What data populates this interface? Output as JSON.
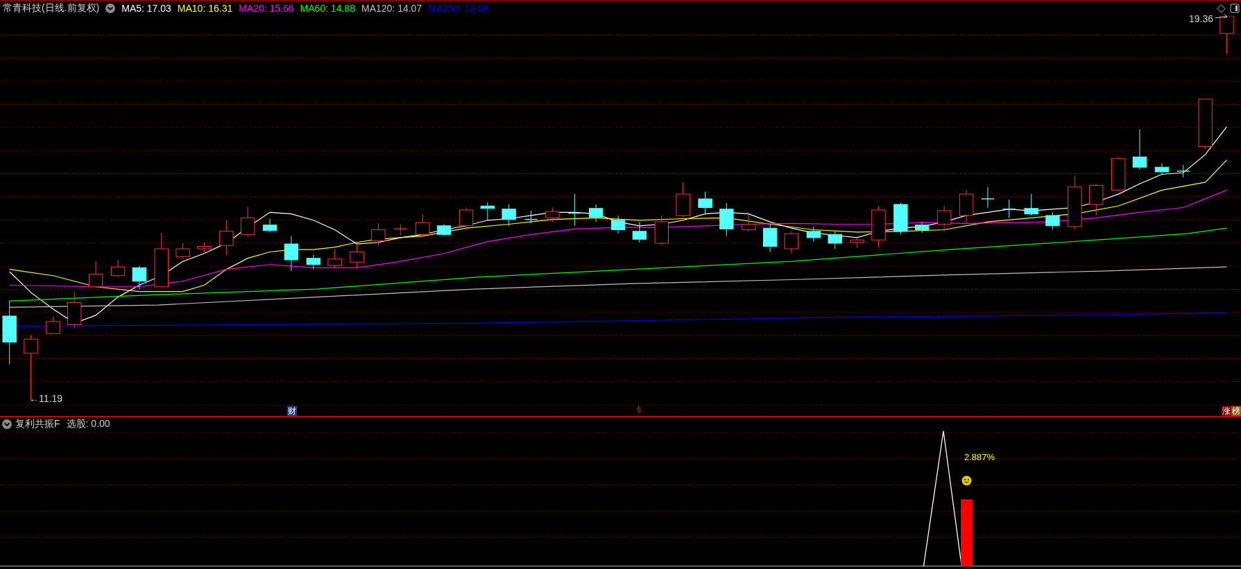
{
  "main_panel": {
    "title": "常青科技(日线.前复权)",
    "moving_averages": [
      {
        "label": "MA5: 17.03",
        "color": "#ffffff"
      },
      {
        "label": "MA10: 16.31",
        "color": "#ffff00"
      },
      {
        "label": "MA20: 15.66",
        "color": "#ff00ff"
      },
      {
        "label": "MA60: 14.88",
        "color": "#00ff00"
      },
      {
        "label": "MA120: 14.07",
        "color": "#c0c0c0"
      },
      {
        "label": "MA250: 13.08",
        "color": "#0000ff"
      }
    ],
    "high_label": "19.36",
    "low_label": "←11.19",
    "markers": [
      {
        "kind": "finance",
        "text": "财"
      },
      {
        "kind": "event",
        "text": "ŝ"
      },
      {
        "kind": "limit-up",
        "text": "涨"
      },
      {
        "kind": "rank",
        "text": "榜"
      }
    ]
  },
  "indicator_panel": {
    "title": "复利共振F",
    "output": "选股: 0.00",
    "annotation": "2.887%"
  }
}
